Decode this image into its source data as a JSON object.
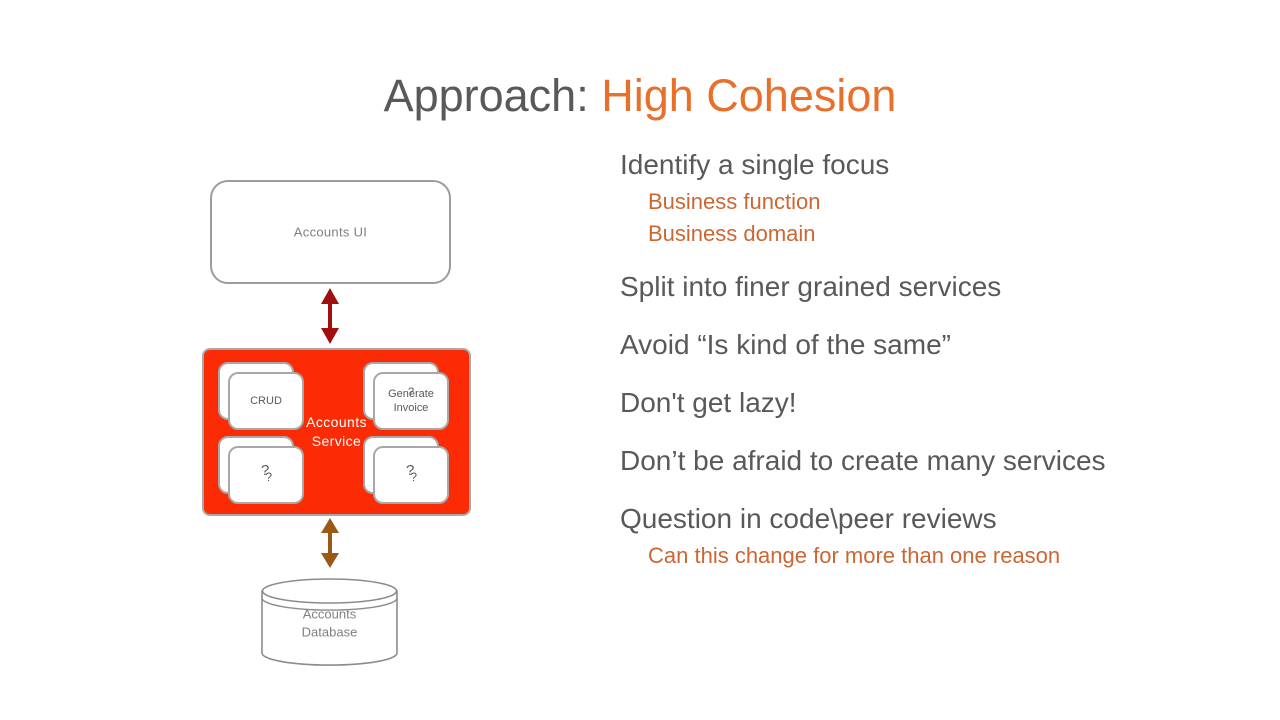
{
  "slide": {
    "title_prefix": "Approach: ",
    "title_accent": "High Cohesion"
  },
  "bullets": [
    {
      "text": "Identify a single focus",
      "level": 1
    },
    {
      "text": "Business function",
      "level": 2
    },
    {
      "text": "Business domain",
      "level": 2
    },
    {
      "text": "Split into finer grained services",
      "level": 1
    },
    {
      "text": "Avoid “Is kind of the same”",
      "level": 1
    },
    {
      "text": "Don't get lazy!",
      "level": 1
    },
    {
      "text": "Don’t be afraid to create many services",
      "level": 1
    },
    {
      "text": "Question in code\\peer reviews",
      "level": 1
    },
    {
      "text": "Can this change for more than one reason",
      "level": 2
    }
  ],
  "diagram": {
    "ui_box_label": "Accounts UI",
    "service_box_label": "Accounts\nService",
    "service_label_line1": "Accounts",
    "service_label_line2": "Service",
    "cards": [
      {
        "id": "crud",
        "label": "CRUD"
      },
      {
        "id": "invoice",
        "label_line1": "Generate",
        "label_line2": "Invoice",
        "overlap": "?"
      },
      {
        "id": "q1",
        "big": "?",
        "small": "?"
      },
      {
        "id": "q2",
        "big": "?",
        "small": "?"
      }
    ],
    "database_label_line1": "Accounts",
    "database_label_line2": "Database",
    "arrow_ui_service_color": "#A01010",
    "arrow_service_db_color": "#9A5A16"
  },
  "colors": {
    "title_gray": "#595959",
    "title_accent": "#E8702A",
    "sub_bullet_orange": "#CC6633",
    "service_red": "#FA2B05",
    "outline_gray": "#9C9C9C",
    "background": "#FFFFFF"
  }
}
